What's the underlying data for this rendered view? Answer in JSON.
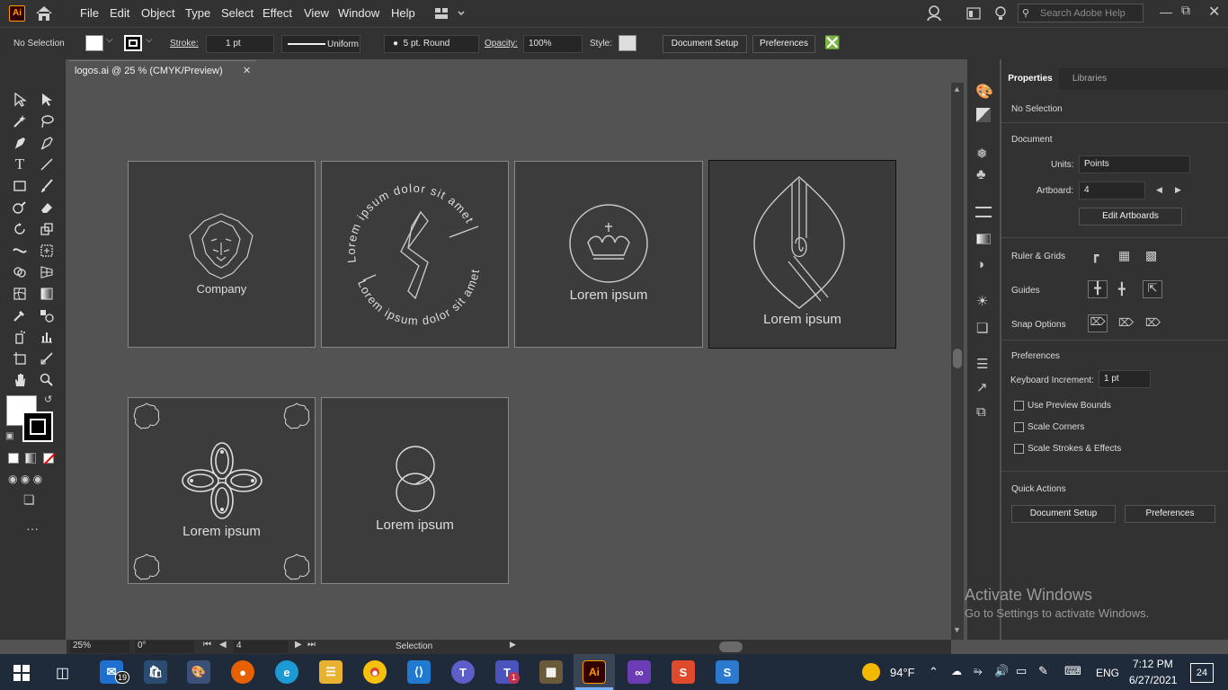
{
  "app": {
    "logo": "Ai"
  },
  "menubar": {
    "items": [
      "File",
      "Edit",
      "Object",
      "Type",
      "Select",
      "Effect",
      "View",
      "Window",
      "Help"
    ],
    "search_placeholder": "Search Adobe Help"
  },
  "control": {
    "selection": "No Selection",
    "stroke_label": "Stroke:",
    "stroke_value": "1 pt",
    "profile": "Uniform",
    "brush": "5 pt. Round",
    "opacity_label": "Opacity:",
    "opacity_value": "100%",
    "style_label": "Style:",
    "doc_setup": "Document Setup",
    "preferences": "Preferences"
  },
  "document_tab": {
    "title": "logos.ai @ 25 % (CMYK/Preview)"
  },
  "artboards": {
    "ab1_text": "Company",
    "ab2_top": "Lorem ipsum dolor sit amet",
    "ab2_bottom": "Lorem ipsum dolor sit amet",
    "ab3_text": "Lorem ipsum",
    "ab4_text": "Lorem ipsum",
    "ab5_text": "Lorem ipsum",
    "ab6_text": "Lorem ipsum"
  },
  "statusbar": {
    "zoom": "25%",
    "rotation": "0°",
    "artboard": "4",
    "tool": "Selection"
  },
  "panel": {
    "tab_properties": "Properties",
    "tab_libraries": "Libraries",
    "selection": "No Selection",
    "document": "Document",
    "units_label": "Units:",
    "units_value": "Points",
    "artboard_label": "Artboard:",
    "artboard_value": "4",
    "edit_artboards": "Edit Artboards",
    "ruler_grids": "Ruler & Grids",
    "guides": "Guides",
    "snap_options": "Snap Options",
    "preferences": "Preferences",
    "keyboard_increment_label": "Keyboard Increment:",
    "keyboard_increment_value": "1 pt",
    "use_preview_bounds": "Use Preview Bounds",
    "scale_corners": "Scale Corners",
    "scale_strokes": "Scale Strokes & Effects",
    "quick_actions": "Quick Actions",
    "qa_doc_setup": "Document Setup",
    "qa_preferences": "Preferences"
  },
  "watermark": {
    "line1": "Activate Windows",
    "line2": "Go to Settings to activate Windows."
  },
  "taskbar": {
    "mail_badge": "19",
    "teams_badge": "1",
    "weather": "94°F",
    "language": "ENG",
    "time": "7:12 PM",
    "date": "6/27/2021",
    "notifications": "24"
  },
  "colors": {
    "accent_ai": "#ff9a00",
    "ai_bg": "#330000",
    "taskbar": "#1f2b3a"
  }
}
